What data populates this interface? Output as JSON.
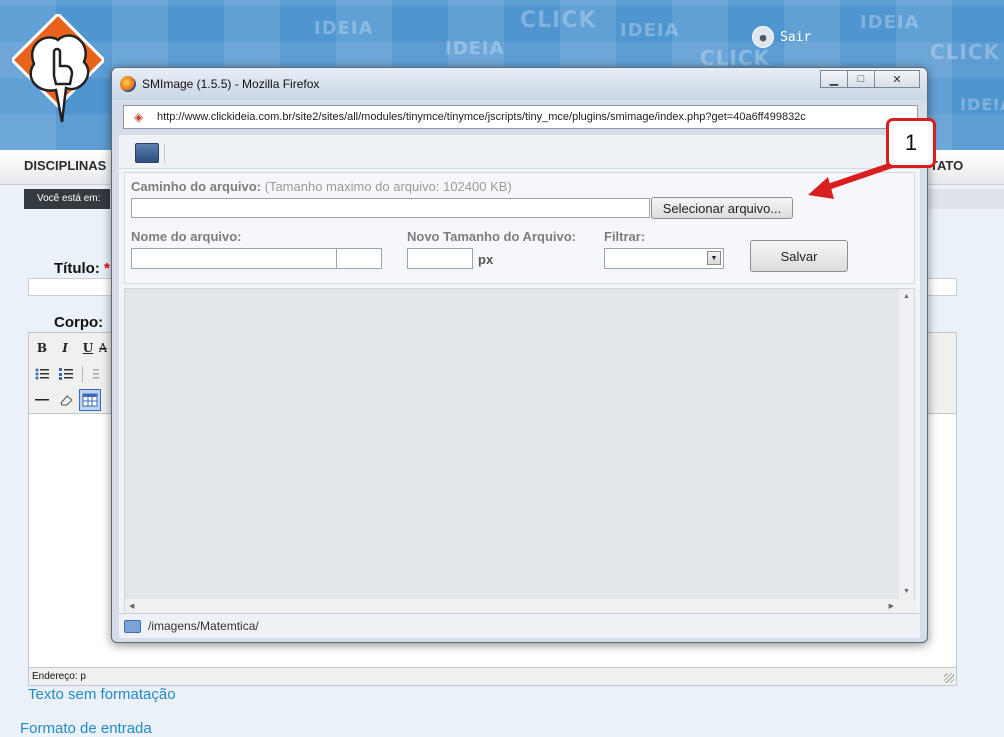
{
  "header": {
    "watermark_words": [
      "IDEIA",
      "IDEIA",
      "CLICK",
      "IDEIA",
      "CLICK",
      "IDEIA",
      "CLICK",
      "IDEIA"
    ],
    "logout_label": "Sair"
  },
  "nav": {
    "left_label": "DISCIPLINAS",
    "right_label": "TATO"
  },
  "breadcrumb": {
    "label": "Você está em:"
  },
  "form": {
    "title_label": "Título:",
    "required_mark": "*",
    "body_label": "Corpo:",
    "editor_status": "Endereço: p",
    "links": [
      "Texto sem formatação",
      "Formato de entrada"
    ]
  },
  "editor_toolbar": {
    "row1": [
      "B",
      "I",
      "U",
      "A"
    ],
    "icons": [
      "bold-icon",
      "italic-icon",
      "underline-icon",
      "strikethrough-icon",
      "bullet-list-icon",
      "numbered-list-icon",
      "outdent-icon",
      "horizontal-rule-icon",
      "eraser-icon",
      "table-icon"
    ]
  },
  "popup": {
    "title": "SMImage (1.5.5) - Mozilla Firefox",
    "url": "http://www.clickideia.com.br/site2/sites/all/modules/tinymce/tinymce/jscripts/tiny_mce/plugins/smimage/index.php?get=40a6ff499832c",
    "window_buttons": {
      "minimize": "▁",
      "maximize": "□",
      "close": "✕"
    },
    "file_path_label": "Caminho do arquivo:",
    "file_path_note": "(Tamanho maximo do arquivo: 102400 KB)",
    "file_path_value": "",
    "browse_button": "Selecionar arquivo...",
    "file_name_label": "Nome do arquivo:",
    "file_name_value": "",
    "new_size_label": "Novo Tamanho do Arquivo:",
    "new_size_value": "",
    "new_size_unit": "px",
    "filter_label": "Filtrar:",
    "filter_value": "",
    "save_button": "Salvar",
    "status_path": "/imagens/Matemtica/"
  },
  "annotation": {
    "number": "1",
    "color": "#d81e1e"
  },
  "colors": {
    "header_blue": "#4f95d0",
    "link_blue": "#2489c9"
  }
}
